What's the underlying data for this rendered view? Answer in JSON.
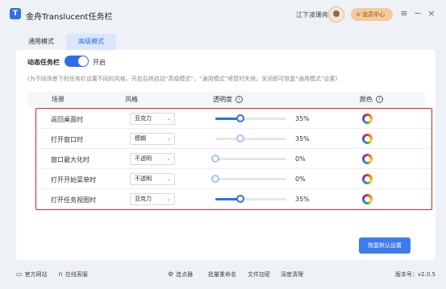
{
  "app": {
    "logo_char": "T",
    "title": "金舟Translucent任务栏",
    "user_name": "江下凌珊亮",
    "vip_label": "会员中心",
    "vip_icon": "crown-icon"
  },
  "window_controls": {
    "menu": "≡",
    "minimize": "−",
    "close": "×"
  },
  "tabs": [
    {
      "label": "通用模式",
      "active": false
    },
    {
      "label": "高级模式",
      "active": true
    }
  ],
  "settings": {
    "dynamic_label": "动态任务栏",
    "dynamic_state": "开启",
    "dynamic_on": true,
    "hint": "(为不同场景下的任务栏设置不同的风格，开启后将启动“高级模式”，“通用模式”将暂时失效，关闭即可恢复“通用模式”设置)"
  },
  "table": {
    "headers": {
      "scene": "场景",
      "style": "风格",
      "opacity": "透明度",
      "color": "颜色"
    },
    "rows": [
      {
        "scene": "返回桌面时",
        "style": "亚克力",
        "percent": "35%",
        "value": 35
      },
      {
        "scene": "打开窗口时",
        "style": "模糊",
        "percent": "35%",
        "value": 35
      },
      {
        "scene": "窗口最大化时",
        "style": "不透明",
        "percent": "0%",
        "value": 0
      },
      {
        "scene": "打开开始菜单时",
        "style": "不透明",
        "percent": "0%",
        "value": 0
      },
      {
        "scene": "打开任务视图时",
        "style": "亚克力",
        "percent": "35%",
        "value": 35
      }
    ]
  },
  "restore_button": "恢复默认设置",
  "footer": {
    "left": [
      {
        "label": "官方网站",
        "icon": "monitor-icon"
      },
      {
        "label": "在线客服",
        "icon": "headset-icon"
      }
    ],
    "middle": [
      {
        "label": "连点器",
        "icon": "gear-icon"
      },
      {
        "label": "批量重命名"
      },
      {
        "label": "文件加密"
      },
      {
        "label": "深度清理"
      }
    ],
    "version": "版本号：v2.0.5"
  },
  "colors": {
    "accent": "#2f6fe6",
    "highlight_border": "#e02020",
    "vip": "#f6c99a"
  }
}
